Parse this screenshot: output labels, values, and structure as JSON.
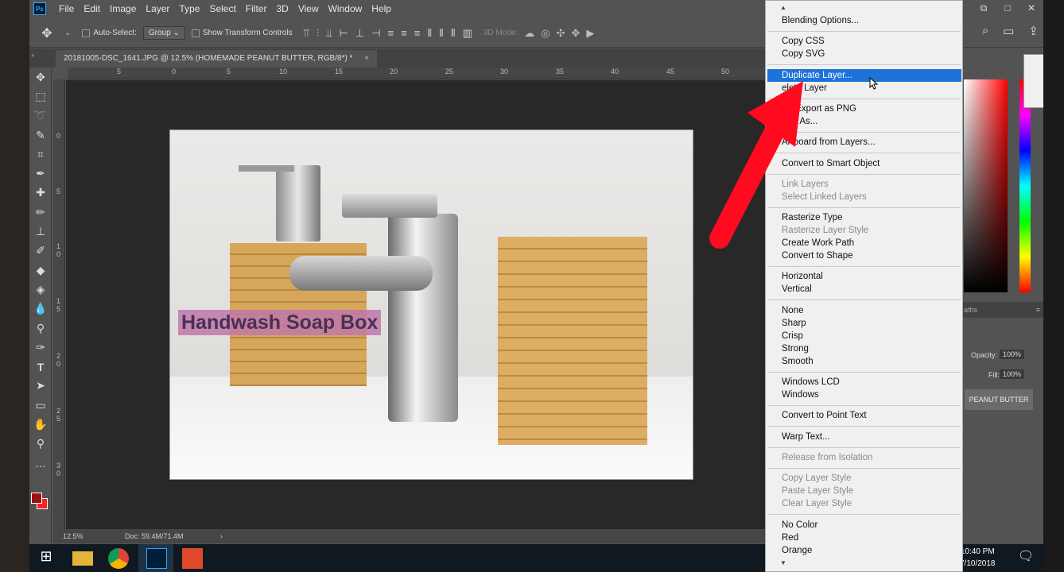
{
  "app": {
    "logo": "Ps",
    "menu": [
      "File",
      "Edit",
      "Image",
      "Layer",
      "Type",
      "Select",
      "Filter",
      "3D",
      "View",
      "Window",
      "Help"
    ],
    "window_controls": [
      "⧉",
      "□",
      "✕"
    ]
  },
  "options": {
    "auto_select_label": "Auto-Select:",
    "auto_select_value": "Group",
    "transform_label": "Show Transform Controls",
    "mode_3d": "3D Mode:"
  },
  "document": {
    "tab_title": "20181005-DSC_1641.JPG @ 12.5% (HOMEMADE PEANUT BUTTER, RGB/8*) *",
    "tab_close": "×",
    "ruler_h": [
      "5",
      "0",
      "5",
      "10",
      "15",
      "20",
      "25",
      "30",
      "35",
      "40",
      "45",
      "50"
    ],
    "ruler_v": [
      "0",
      "5",
      "1 0",
      "1 5",
      "2 0",
      "2 5",
      "3 0"
    ],
    "caption": "Handwash Soap Box"
  },
  "status": {
    "zoom": "12.5%",
    "doc": "Doc: 59.4M/71.4M",
    "arrow": "›"
  },
  "layers_panel": {
    "tab": "aths",
    "opacity_label": "Opacity:",
    "opacity_value": "100%",
    "fill_label": "Fill:",
    "fill_value": "100%",
    "layer_name": "PEANUT BUTTER"
  },
  "taskbar": {
    "time": "10:40 PM",
    "date": "7/10/2018"
  },
  "context_menu": {
    "items": [
      {
        "label": "Blending Options...",
        "enabled": true
      },
      {
        "label": "Copy CSS",
        "enabled": true
      },
      {
        "label": "Copy SVG",
        "enabled": true
      },
      {
        "label": "Duplicate Layer...",
        "enabled": true,
        "highlighted": true
      },
      {
        "label": "elete Layer",
        "enabled": true
      },
      {
        "label": "ick Export as PNG",
        "enabled": true
      },
      {
        "label": "port As...",
        "enabled": true
      },
      {
        "label": "Artboard from Layers...",
        "enabled": true
      },
      {
        "label": "Convert to Smart Object",
        "enabled": true
      },
      {
        "label": "Link Layers",
        "enabled": false
      },
      {
        "label": "Select Linked Layers",
        "enabled": false
      },
      {
        "label": "Rasterize Type",
        "enabled": true
      },
      {
        "label": "Rasterize Layer Style",
        "enabled": false
      },
      {
        "label": "Create Work Path",
        "enabled": true
      },
      {
        "label": "Convert to Shape",
        "enabled": true
      },
      {
        "label": "Horizontal",
        "enabled": true
      },
      {
        "label": "Vertical",
        "enabled": true
      },
      {
        "label": "None",
        "enabled": true
      },
      {
        "label": "Sharp",
        "enabled": true
      },
      {
        "label": "Crisp",
        "enabled": true
      },
      {
        "label": "Strong",
        "enabled": true
      },
      {
        "label": "Smooth",
        "enabled": true
      },
      {
        "label": "Windows LCD",
        "enabled": true
      },
      {
        "label": "Windows",
        "enabled": true
      },
      {
        "label": "Convert to Point Text",
        "enabled": true
      },
      {
        "label": "Warp Text...",
        "enabled": true
      },
      {
        "label": "Release from Isolation",
        "enabled": false
      },
      {
        "label": "Copy Layer Style",
        "enabled": false
      },
      {
        "label": "Paste Layer Style",
        "enabled": false
      },
      {
        "label": "Clear Layer Style",
        "enabled": false
      },
      {
        "label": "No Color",
        "enabled": true
      },
      {
        "label": "Red",
        "enabled": true
      },
      {
        "label": "Orange",
        "enabled": true
      }
    ]
  },
  "colors": {
    "highlight": "#1e73d8",
    "annotation_arrow": "#ff0a1e",
    "foreground": "#a01010",
    "background": "#ff2020"
  }
}
